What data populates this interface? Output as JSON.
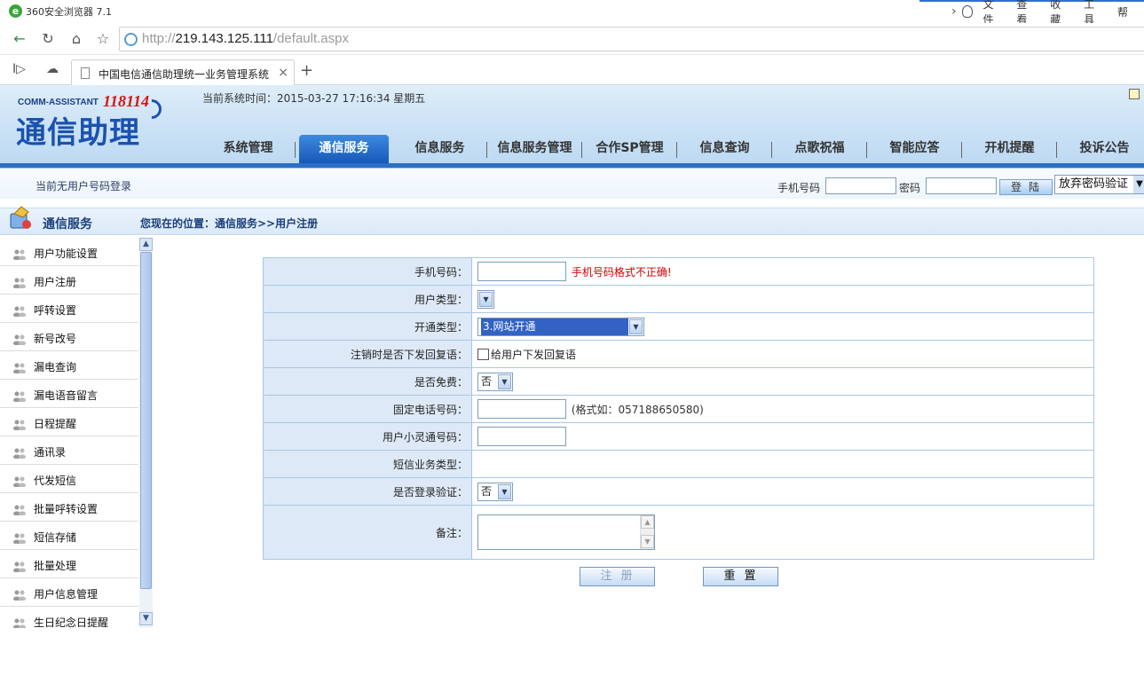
{
  "browser": {
    "brand": "360安全浏览器 7.1",
    "menu": [
      "文件",
      "查看",
      "收藏",
      "工具",
      "帮"
    ],
    "url_scheme": "http://",
    "url_host": "219.143.125.111",
    "url_path": "/default.aspx",
    "tab_title": "中国电信通信助理统一业务管理系统",
    "tab_close": "×",
    "new_tab": "+"
  },
  "header": {
    "logo_en": "COMM-ASSISTANT",
    "logo_num": "118114",
    "logo_cn": "通信助理",
    "systime": "当前系统时间：2015-03-27 17:16:34 星期五",
    "nav": [
      {
        "label": "系统管理",
        "active": false
      },
      {
        "label": "通信服务",
        "active": true
      },
      {
        "label": "信息服务",
        "active": false
      },
      {
        "label": "信息服务管理",
        "active": false
      },
      {
        "label": "合作SP管理",
        "active": false
      },
      {
        "label": "信息查询",
        "active": false
      },
      {
        "label": "点歌祝福",
        "active": false
      },
      {
        "label": "智能应答",
        "active": false
      },
      {
        "label": "开机提醒",
        "active": false
      },
      {
        "label": "投诉公告",
        "active": false
      }
    ]
  },
  "loginbar": {
    "status": "当前无用户号码登录",
    "phone_label": "手机号码",
    "password_label": "密码",
    "login_button": "登陆",
    "pw_option": "放弃密码验证"
  },
  "section": {
    "title": "通信服务",
    "breadcrumb": "您现在的位置：通信服务>>用户注册"
  },
  "sidebar": {
    "items": [
      "用户功能设置",
      "用户注册",
      "呼转设置",
      "新号改号",
      "漏电查询",
      "漏电语音留言",
      "日程提醒",
      "通讯录",
      "代发短信",
      "批量呼转设置",
      "短信存储",
      "批量处理",
      "用户信息管理",
      "生日纪念日提醒"
    ]
  },
  "form": {
    "phone_label": "手机号码：",
    "phone_error": "手机号码格式不正确!",
    "user_type_label": "用户类型：",
    "open_type_label": "开通类型：",
    "open_type_value": "3.网站开通",
    "cancel_reply_label": "注销时是否下发回复语：",
    "cancel_reply_checkbox": "给用户下发回复语",
    "free_label": "是否免费：",
    "free_value": "否",
    "landline_label": "固定电话号码：",
    "landline_hint": "(格式如：057188650580)",
    "phs_label": "用户小灵通号码：",
    "sms_type_label": "短信业务类型：",
    "login_verify_label": "是否登录验证：",
    "login_verify_value": "否",
    "remark_label": "备注：",
    "register_button": "注册",
    "reset_button": "重置"
  }
}
